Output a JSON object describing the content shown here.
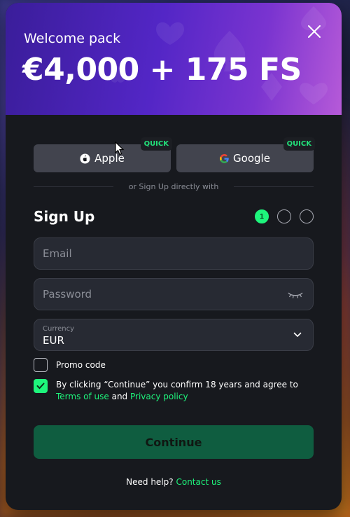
{
  "banner": {
    "subtitle": "Welcome pack",
    "title": "€4,000 + 175 FS"
  },
  "social": {
    "apple_label": "Apple",
    "google_label": "Google",
    "quick_badge": "QUICK"
  },
  "divider_text": "or Sign Up directly with",
  "signup": {
    "title": "Sign Up",
    "steps": [
      "1",
      "",
      ""
    ],
    "active_step": 1
  },
  "form": {
    "email_placeholder": "Email",
    "password_placeholder": "Password",
    "currency_label": "Currency",
    "currency_value": "EUR",
    "promo_label": "Promo code",
    "promo_checked": false,
    "terms_checked": true,
    "terms_prefix": "By clicking “Continue” you confirm 18 years and agree to ",
    "terms_link": "Terms of use",
    "terms_and": " and ",
    "privacy_link": "Privacy policy"
  },
  "continue_label": "Continue",
  "help": {
    "text": "Need help?",
    "link": "Contact us"
  },
  "colors": {
    "accent": "#1ef57c",
    "modal_bg": "#17191e",
    "button_bg": "#42444e",
    "continue_bg": "#0f5d40",
    "banner_start": "#3a1d9a",
    "banner_end": "#b65ad8"
  }
}
